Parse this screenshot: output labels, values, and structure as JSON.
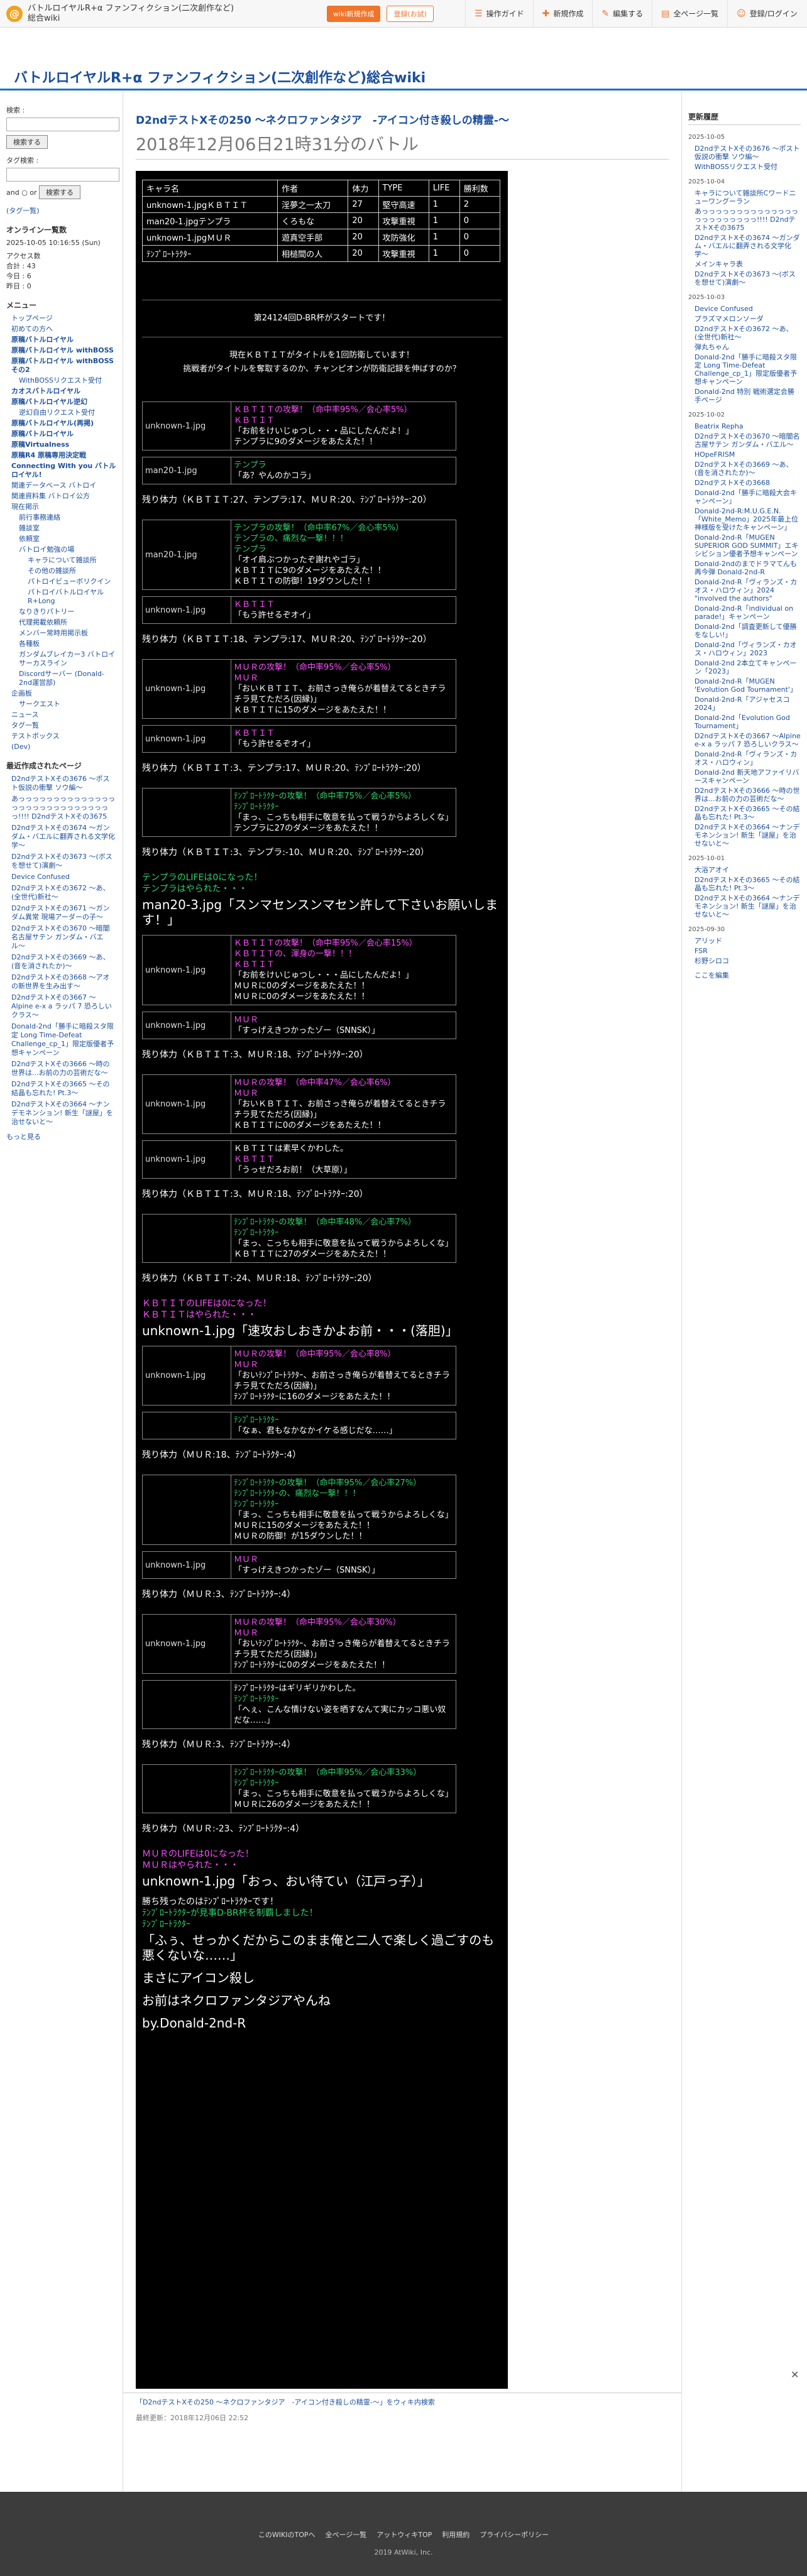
{
  "topbar": {
    "logo": "@",
    "site_name": "バトルロイヤルR+α ファンフィクション(二次創作など)総合wiki",
    "wiki_btn": "wiki新規作成",
    "login_btn": "登録(お試)",
    "nav": [
      {
        "icon": "☰",
        "label": "操作ガイド"
      },
      {
        "icon": "✚",
        "label": "新規作成"
      },
      {
        "icon": "✎",
        "label": "編集する"
      },
      {
        "icon": "▤",
        "label": "全ページ一覧"
      },
      {
        "icon": "☺",
        "label": "登録/ログイン"
      }
    ]
  },
  "wiki_title": "バトルロイヤルR+α ファンフィクション(二次創作など)総合wiki",
  "left": {
    "search_label": "検索 :",
    "search_btn": "検索する",
    "tag_label": "タグ検索 :",
    "and": "and ○ or",
    "search_btn2": "検索する",
    "tag_note": "(タグ一覧)",
    "online_title": "オンライン一覧数",
    "online_date": "2025-10-05 10:16:55 (Sun)",
    "counts": [
      "アクセス数",
      "合計 : 43",
      "今日 : 6",
      "昨日 : 0"
    ],
    "menu_title": "メニュー",
    "menu": [
      {
        "label": "トップページ",
        "cls": ""
      },
      {
        "label": "初めての方へ",
        "cls": ""
      },
      {
        "label": "原稿バトルロイヤル",
        "cls": "bold"
      },
      {
        "label": "原稿バトルロイヤル withBOSS",
        "cls": "bold"
      },
      {
        "label": "原稿バトルロイヤル withBOSSその2",
        "cls": "bold"
      },
      {
        "label": "WithBOSSリクエスト受付",
        "cls": "sub"
      },
      {
        "label": "カオスバトルロイヤル",
        "cls": "bold"
      },
      {
        "label": "原稿バトルロイヤル逆幻",
        "cls": "bold"
      },
      {
        "label": "逆幻自由リクエスト受付",
        "cls": "sub"
      },
      {
        "label": "原稿バトルロイヤル(再掲)",
        "cls": "bold"
      },
      {
        "label": "原稿バトルロイヤル",
        "cls": "bold"
      },
      {
        "label": "原稿Virtualness",
        "cls": "bold"
      },
      {
        "label": "原稿R4 原稿専用決定戦",
        "cls": "bold"
      },
      {
        "label": "Connecting With you バトルロイヤル!",
        "cls": "bold"
      },
      {
        "label": "関連データベース バトロイ",
        "cls": ""
      },
      {
        "label": "関連資料集 バトロイ公方",
        "cls": ""
      },
      {
        "label": "現在掲示",
        "cls": ""
      },
      {
        "label": "前行事務連絡",
        "cls": "sub"
      },
      {
        "label": "雑談室",
        "cls": "sub"
      },
      {
        "label": "依頼室",
        "cls": "sub"
      },
      {
        "label": "バトロイ勉強の場",
        "cls": "sub"
      },
      {
        "label": "キャラについて雑談所",
        "cls": "sub2"
      },
      {
        "label": "その他の雑談所",
        "cls": "sub2"
      },
      {
        "label": "パトロイビューボリクイン",
        "cls": "sub2"
      },
      {
        "label": "パトロイバトルロイヤルR+Long",
        "cls": "sub2"
      },
      {
        "label": "なりきりパトリー",
        "cls": "sub"
      },
      {
        "label": "代理掲載依頼所",
        "cls": "sub"
      },
      {
        "label": "メンバー常時用掲示板",
        "cls": "sub"
      },
      {
        "label": "各種板",
        "cls": "sub"
      },
      {
        "label": "ガンダムブレイカー3 バトロイサーカスライン",
        "cls": "sub"
      },
      {
        "label": "Discordサーバー (Donald-2nd運営部)",
        "cls": "sub"
      },
      {
        "label": "企画板",
        "cls": ""
      },
      {
        "label": "サークエスト",
        "cls": "sub"
      },
      {
        "label": "ニュース",
        "cls": ""
      },
      {
        "label": "タグ一覧",
        "cls": ""
      },
      {
        "label": "テストボックス",
        "cls": ""
      },
      {
        "label": "(Dev)",
        "cls": ""
      }
    ],
    "recent_title": "最近作成されたページ",
    "recent": [
      "D2ndテストXその3676 〜ポスト仮説の衝撃 ソウ編〜",
      "あっっっっっっっっっっっっっっっっっっっっっっっっっっっっっ!!!! D2ndテストXその3675",
      "D2ndテストXその3674 〜ガンダム・バエルに翻弄される文学化学〜",
      "D2ndテストXその3673 〜(ボスを想せて)演劇〜",
      "Device Confused",
      "D2ndテストXその3672 〜あ、(全世代)新社〜",
      "D2ndテストXその3671 〜ガンダム異常 現場アーダーの子〜",
      "D2ndテストXその3670 〜暗闇名古屋サテン ガンダム・バエル〜",
      "D2ndテストXその3669 〜あ、(音を消されたか)〜",
      "D2ndテストXその3668 〜アオの新世界を生み出す〜",
      "D2ndテストXその3667 〜Alpine e-x a ラッパ 7 恐ろしいクラス〜",
      "Donald-2nd「勝手に暗殺スタ限定 Long Time-Defeat Challenge_cp_1」限定版優者予想キャンペーン",
      "D2ndテストXその3666 〜時の世界は...お前の力の芸術だな〜",
      "D2ndテストXその3665 〜その結晶も忘れた! Pt.3〜",
      "D2ndテストXその3664 〜ナンデモネンション! 新生「謎屋」を治せないと〜"
    ],
    "more": "もっと見る"
  },
  "right": {
    "title": "更新履歴",
    "groups": [
      {
        "date": "2025-10-05",
        "items": [
          "D2ndテストXその3676 〜ポスト仮説の衝撃 ソウ編〜",
          "WithBOSSリクエスト受付"
        ]
      },
      {
        "date": "2025-10-04",
        "items": [
          "キャラについて雑談所Cワードニューワングーラン",
          "あっっっっっっっっっっっっっっっっっっっっっっっ!!!! D2ndテストXその3675",
          "D2ndテストXその3674 〜ガンダム・バエルに翻弄される文学化学〜",
          "メインキャラ表",
          "D2ndテストXその3673 〜(ボスを想せて)演劇〜"
        ]
      },
      {
        "date": "2025-10-03",
        "items": [
          "Device Confused",
          "プラズマメロンソーダ",
          "D2ndテストXその3672 〜あ、(全世代)新社〜",
          "弾丸ちゃん",
          "Donald-2nd「勝手に暗殺スタ限定 Long Time-Defeat Challenge_cp_1」限定版優者予想キャンペーン",
          "Donald-2nd 特別 戦術選定会勝手ページ"
        ]
      },
      {
        "date": "2025-10-02",
        "items": [
          "Beatrix Repha",
          "D2ndテストXその3670 〜暗闇名古屋サテン ガンダム・バエル〜",
          "HOpeFRISM",
          "D2ndテストXその3669 〜あ、(音を消されたか)〜",
          "D2ndテストXその3668",
          "Donald-2nd「勝手に暗殺大会キャンペーン」",
          "Donald-2nd-R:M.U.G.E.N.「White_Memo」2025年最上位神様版を受けたキャンペーン」",
          "Donald-2nd-R「MUGEN SUPERIOR GOD SUMMIT」エキシビション優者予想キャンペーン",
          "Donald-2ndのまでドラマてんも再今弾 Donald-2nd-R",
          "Donald-2nd-R「ヴィランズ・カオス・ハロウィン」2024 \"involved the authors\"",
          "Donald-2nd-R「individual on parade!」キャンペーン",
          "Donald-2nd「調査更新して優勝をなしい!」",
          "Donald-2nd「ヴィランズ・カオス・ハロウィン」2023",
          "Donald-2nd 2本立てキャンペーン「2023」",
          "Donald-2nd-R「MUGEN 'Evolution God Tournament'」",
          "Donald-2nd-R「アジャセスコ 2024」",
          "Donald-2nd「Evolution God Tournament」",
          "D2ndテストXその3667 〜Alpine e-x a ラッパ 7 恐ろしいクラス〜",
          "Donald-2nd-R「ヴィランズ・カオス・ハロウィン」",
          "Donald-2nd 新天地アファイリバースキャンペーン",
          "D2ndテストXその3666 〜時の世界は...お前の力の芸術だな〜",
          "D2ndテストXその3665 〜その結晶も忘れた! Pt.3〜",
          "D2ndテストXその3664 〜ナンデモネンション! 新生「謎屋」を治せないと〜"
        ]
      },
      {
        "date": "2025-10-01",
        "items": [
          "大浴アオイ",
          "D2ndテストXその3665 〜その結晶も忘れた! Pt.3〜",
          "D2ndテストXその3664 〜ナンデモネンション! 新生「謎屋」を治せないと〜"
        ]
      },
      {
        "date": "2025-09-30",
        "items": [
          "アリッド",
          "FSR",
          "杉野シロコ"
        ]
      }
    ],
    "more": "ここを編集"
  },
  "main": {
    "title": "D2ndテストXその250 〜ネクロファンタジア　-アイコン付き殺しの精霊-〜",
    "subtitle": "2018年12月06日21時31分のバトル",
    "table_head": [
      "キャラ名",
      "作者",
      "体力",
      "TYPE",
      "LIFE",
      "勝利数"
    ],
    "table_rows": [
      [
        "unknown-1.jpgＫＢＴＩＴ",
        "淫夢之一太刀",
        "27",
        "堅守高速",
        "1",
        "2"
      ],
      [
        "man20-1.jpgテンプラ",
        "くろもな",
        "20",
        "攻撃重視",
        "1",
        "0"
      ],
      [
        "unknown-1.jpgＭＵＲ",
        "遊真空手部",
        "20",
        "攻防強化",
        "1",
        "0"
      ],
      [
        "ﾃﾝﾌﾟﾛｰﾄﾗｸﾀｰ",
        "相槌間の人",
        "20",
        "攻撃重視",
        "1",
        "0"
      ]
    ],
    "announce1": "第24124回D-BR杯がスタートです！",
    "announce2": "現在ＫＢＴＩＴがタイトルを1回防衛しています！",
    "announce3": "挑戦者がタイトルを奪取するのか、チャンピオンが防衛記録を伸ばすのか？",
    "events": [
      {
        "img": "unknown-1.jpg",
        "lines": [
          "ＫＢＴＩＴの攻撃！（命中率95%／会心率5%）",
          "ＫＢＴＩＴ",
          "「お前をけいじゅつし・・・品にしたんだよ！」",
          "テンプラに9のダメージをあたえた！！"
        ]
      },
      {
        "img": "man20-1.jpg",
        "lines": [
          "テンプラ",
          "「あ？やんのかコラ」"
        ]
      },
      {
        "hp": "残り体力（ＫＢＴＩＴ:27、テンプラ:17、ＭＵＲ:20、ﾃﾝﾌﾟﾛｰﾄﾗｸﾀｰ:20）"
      },
      {
        "img": "man20-1.jpg",
        "lines": [
          "テンプラの攻撃！（命中率67%／会心率5%）",
          "テンプラの、痛烈な一撃！！！",
          "テンプラ",
          "「オイ肩ぶつかったぞ謝れやゴラ」",
          "ＫＢＴＩＴに9のダメージをあたえた！！",
          "ＫＢＴＩＴの防御！19ダウンした！！"
        ]
      },
      {
        "img": "unknown-1.jpg",
        "lines": [
          "ＫＢＴＩＴ",
          "「もう許せるぞオイ」"
        ]
      },
      {
        "hp": "残り体力（ＫＢＴＩＴ:18、テンプラ:17、ＭＵＲ:20、ﾃﾝﾌﾟﾛｰﾄﾗｸﾀｰ:20）"
      },
      {
        "img": "unknown-1.jpg",
        "lines": [
          "ＭＵＲの攻撃！（命中率95%／会心率5%）",
          "ＭＵＲ",
          "「おいＫＢＴＩＴ、お前さっき俺らが着替えてるときチラチラ見てただろ(因縁)」",
          "ＫＢＴＩＴに15のダメージをあたえた！！"
        ]
      },
      {
        "img": "unknown-1.jpg",
        "lines": [
          "ＫＢＴＩＴ",
          "「もう許せるぞオイ」"
        ]
      },
      {
        "hp": "残り体力（ＫＢＴＩＴ:3、テンプラ:17、ＭＵＲ:20、ﾃﾝﾌﾟﾛｰﾄﾗｸﾀｰ:20）"
      },
      {
        "img": "",
        "lines": [
          "ﾃﾝﾌﾟﾛｰﾄﾗｸﾀｰの攻撃！（命中率75%／会心率5%）",
          "ﾃﾝﾌﾟﾛｰﾄﾗｸﾀｰ",
          "「まっ、こっちも相手に敬意を払って戦うからよろしくな」",
          "テンプラに27のダメージをあたえた！！"
        ]
      },
      {
        "hp": "残り体力（ＫＢＴＩＴ:3、テンプラ:-10、ＭＵＲ:20、ﾃﾝﾌﾟﾛｰﾄﾗｸﾀｰ:20）"
      },
      {
        "text": "テンプラのLIFEは0になった！"
      },
      {
        "text": "テンプラはやられた・・・"
      },
      {
        "big": "man20-3.jpg「スンマセンスンマセン許して下さいお願いします！」"
      },
      {
        "img": "unknown-1.jpg",
        "lines": [
          "ＫＢＴＩＴの攻撃！（命中率95%／会心率15%）",
          "ＫＢＴＩＴの、渾身の一撃！！！",
          "ＫＢＴＩＴ",
          "「お前をけいじゅつし・・・品にしたんだよ！」",
          "ＭＵＲに0のダメージをあたえた！！",
          "ＭＵＲに0のダメージをあたえた！！"
        ]
      },
      {
        "img": "unknown-1.jpg",
        "lines": [
          "ＭＵＲ",
          "「すっげえきつかったゾー（SNNSK）」"
        ]
      },
      {
        "hp": "残り体力（ＫＢＴＩＴ:3、ＭＵＲ:18、ﾃﾝﾌﾟﾛｰﾄﾗｸﾀｰ:20）"
      },
      {
        "img": "unknown-1.jpg",
        "lines": [
          "ＭＵＲの攻撃！（命中率47%／会心率6%）",
          "ＭＵＲ",
          "「おいＫＢＴＩＴ、お前さっき俺らが着替えてるときチラチラ見てただろ(因縁)」",
          "ＫＢＴＩＴに0のダメージをあたえた！！"
        ]
      },
      {
        "img": "unknown-1.jpg",
        "lines": [
          "ＫＢＴＩＴは素早くかわした。",
          "ＫＢＴＩＴ",
          "「うっせだろお前！（大草原）」"
        ]
      },
      {
        "hp": "残り体力（ＫＢＴＩＴ:3、ＭＵＲ:18、ﾃﾝﾌﾟﾛｰﾄﾗｸﾀｰ:20）"
      },
      {
        "img": "",
        "lines": [
          "ﾃﾝﾌﾟﾛｰﾄﾗｸﾀｰの攻撃！（命中率48%／会心率7%）",
          "ﾃﾝﾌﾟﾛｰﾄﾗｸﾀｰ",
          "「まっ、こっちも相手に敬意を払って戦うからよろしくな」",
          "ＫＢＴＩＴに27のダメージをあたえた！！"
        ]
      },
      {
        "hp": "残り体力（ＫＢＴＩＴ:-24、ＭＵＲ:18、ﾃﾝﾌﾟﾛｰﾄﾗｸﾀｰ:20）"
      },
      {
        "text": "ＫＢＴＩＴのLIFEは0になった！"
      },
      {
        "text": "ＫＢＴＩＴはやられた・・・"
      },
      {
        "big": "unknown-1.jpg「速攻おしおきかよお前・・・(落胆)」"
      },
      {
        "img": "unknown-1.jpg",
        "lines": [
          "ＭＵＲの攻撃！（命中率95%／会心率8%）",
          "ＭＵＲ",
          "「おいﾃﾝﾌﾟﾛｰﾄﾗｸﾀｰ、お前さっき俺らが着替えてるときチラチラ見てただろ(因縁)」",
          "ﾃﾝﾌﾟﾛｰﾄﾗｸﾀｰに16のダメージをあたえた！！"
        ]
      },
      {
        "img": "",
        "lines": [
          "ﾃﾝﾌﾟﾛｰﾄﾗｸﾀｰ",
          "「なぁ、君もなかなかイケる感じだな……」"
        ]
      },
      {
        "hp": "残り体力（ＭＵＲ:18、ﾃﾝﾌﾟﾛｰﾄﾗｸﾀｰ:4）"
      },
      {
        "img": "",
        "lines": [
          "ﾃﾝﾌﾟﾛｰﾄﾗｸﾀｰの攻撃！（命中率95%／会心率27%）",
          "ﾃﾝﾌﾟﾛｰﾄﾗｸﾀｰの、痛烈な一撃！！！",
          "ﾃﾝﾌﾟﾛｰﾄﾗｸﾀｰ",
          "「まっ、こっちも相手に敬意を払って戦うからよろしくな」",
          "ＭＵＲに15のダメージをあたえた！！",
          "ＭＵＲの防御！が15ダウンした！！"
        ]
      },
      {
        "img": "unknown-1.jpg",
        "lines": [
          "ＭＵＲ",
          "「すっげえきつかったゾー（SNNSK）」"
        ]
      },
      {
        "hp": "残り体力（ＭＵＲ:3、ﾃﾝﾌﾟﾛｰﾄﾗｸﾀｰ:4）"
      },
      {
        "img": "unknown-1.jpg",
        "lines": [
          "ＭＵＲの攻撃！（命中率95%／会心率30%）",
          "ＭＵＲ",
          "「おいﾃﾝﾌﾟﾛｰﾄﾗｸﾀｰ、お前さっき俺らが着替えてるときチラチラ見てただろ(因縁)」",
          "ﾃﾝﾌﾟﾛｰﾄﾗｸﾀｰに0のダメージをあたえた！！"
        ]
      },
      {
        "img": "",
        "lines": [
          "ﾃﾝﾌﾟﾛｰﾄﾗｸﾀｰはギリギリかわした。",
          "ﾃﾝﾌﾟﾛｰﾄﾗｸﾀｰ",
          "「へぇ、こんな情けない姿を晒すなんて実にカッコ悪い奴だな……」"
        ]
      },
      {
        "hp": "残り体力（ＭＵＲ:3、ﾃﾝﾌﾟﾛｰﾄﾗｸﾀｰ:4）"
      },
      {
        "img": "",
        "lines": [
          "ﾃﾝﾌﾟﾛｰﾄﾗｸﾀｰの攻撃！（命中率95%／会心率33%）",
          "ﾃﾝﾌﾟﾛｰﾄﾗｸﾀｰ",
          "「まっ、こっちも相手に敬意を払って戦うからよろしくな」",
          "ＭＵＲに26のダメージをあたえた！！"
        ]
      },
      {
        "hp": "残り体力（ＭＵＲ:-23、ﾃﾝﾌﾟﾛｰﾄﾗｸﾀｰ:4）"
      },
      {
        "text": "ＭＵＲのLIFEは0になった！"
      },
      {
        "text": "ＭＵＲはやられた・・・"
      },
      {
        "big": "unknown-1.jpg「おっ、おい待てい（江戸っ子）」"
      },
      {
        "text": "勝ち残ったのはﾃﾝﾌﾟﾛｰﾄﾗｸﾀｰです！"
      },
      {
        "text": "ﾃﾝﾌﾟﾛｰﾄﾗｸﾀｰが見事D-BR杯を制覇しました！"
      },
      {
        "text": "ﾃﾝﾌﾟﾛｰﾄﾗｸﾀｰ"
      },
      {
        "big": "「ふぅ、せっかくだからこのまま俺と二人で楽しく過ごすのも悪くないな……」"
      },
      {
        "big": "まさにアイコン殺し"
      },
      {
        "big": "お前はネクロファンタジアやんね"
      },
      {
        "big": "by.Donald-2nd-R"
      }
    ],
    "edit_bar": "「D2ndテストXその250 〜ネクロファンタジア　-アイコン付き殺しの精霊-〜」をウィキ内検索",
    "last_update": "最終更新：2018年12月06日 22:52"
  },
  "footer": {
    "links": [
      "このWIKIのTOPへ",
      "全ページ一覧",
      "アットウィキTOP",
      "利用規約",
      "プライバシーポリシー"
    ],
    "copy": "2019 AtWiki, Inc."
  }
}
